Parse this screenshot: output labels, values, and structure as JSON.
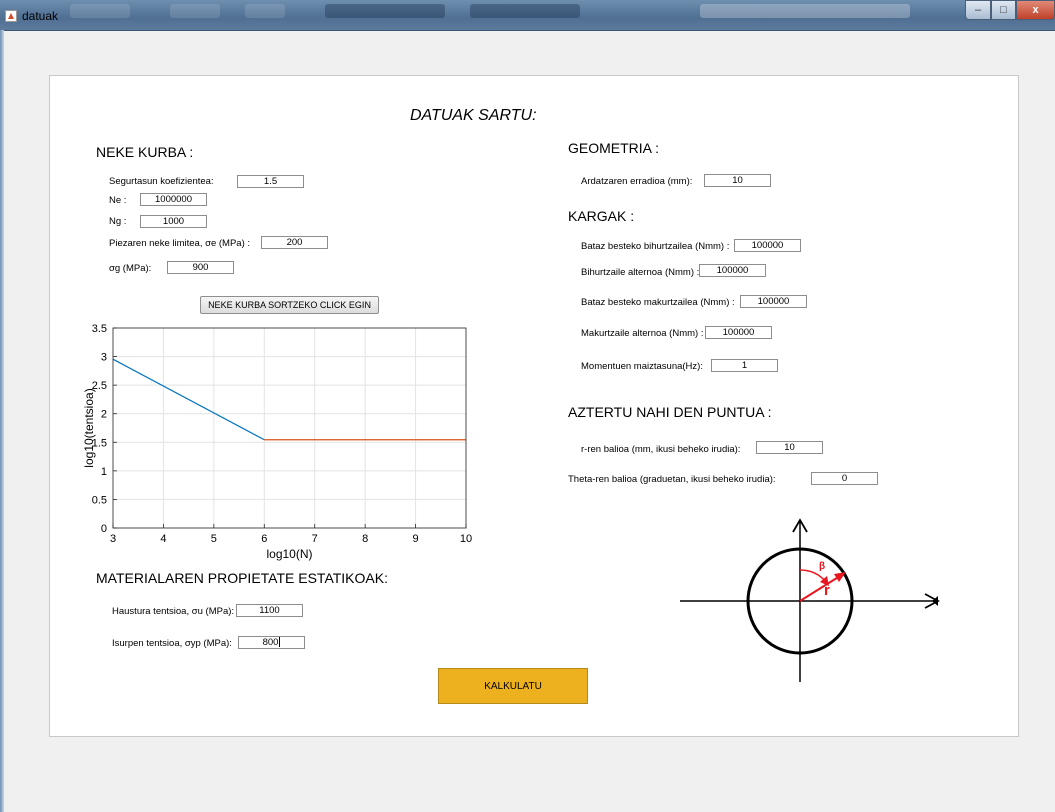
{
  "window": {
    "title": "datuak",
    "minimize": "–",
    "maximize": "□",
    "close": "x"
  },
  "main_title": "DATUAK SARTU:",
  "neke": {
    "heading": "NEKE KURBA :",
    "segurtasun_label": "Segurtasun koefizientea:",
    "segurtasun_value": "1.5",
    "ne_label": "Ne :",
    "ne_value": "1000000",
    "ng_label": "Ng :",
    "ng_value": "1000",
    "limitea_label": "Piezaren neke limitea, σe (MPa) :",
    "limitea_value": "200",
    "sg_label": "σg (MPa):",
    "sg_value": "900",
    "button": "NEKE KURBA SORTZEKO CLICK EGIN"
  },
  "chart_data": {
    "type": "line",
    "xlabel": "log10(N)",
    "ylabel": "log10(tentsioa)",
    "xlim": [
      3,
      10
    ],
    "ylim": [
      0,
      3.5
    ],
    "xticks": [
      "3",
      "4",
      "5",
      "6",
      "7",
      "8",
      "9",
      "10"
    ],
    "yticks": [
      "0",
      "0.5",
      "1",
      "1.5",
      "2",
      "2.5",
      "3",
      "3.5"
    ],
    "grid": true,
    "series": [
      {
        "color": "#0072bd",
        "x": [
          3,
          6
        ],
        "y": [
          2.954,
          1.544
        ]
      },
      {
        "color": "#d95319",
        "x": [
          6,
          10
        ],
        "y": [
          1.544,
          1.544
        ]
      }
    ]
  },
  "materiala": {
    "heading": "MATERIALAREN PROPIETATE ESTATIKOAK:",
    "haustura_label": "Haustura tentsioa, σu (MPa):",
    "haustura_value": "1100",
    "isurpen_label": "Isurpen tentsioa, σyp (MPa):",
    "isurpen_value": "800"
  },
  "geometria": {
    "heading": "GEOMETRIA :",
    "erradioa_label": "Ardatzaren erradioa (mm):",
    "erradioa_value": "10"
  },
  "kargak": {
    "heading": "KARGAK :",
    "bihurtz_label": "Bataz besteko bihurtzailea (Nmm) :",
    "bihurtz_value": "100000",
    "bihurtz_alt_label": "Bihurtzaile alternoa (Nmm) :",
    "bihurtz_alt_value": "100000",
    "makurtz_label": "Bataz besteko makurtzailea (Nmm) :",
    "makurtz_value": "100000",
    "makurtz_alt_label": "Makurtzaile alternoa (Nmm) :",
    "makurtz_alt_value": "100000",
    "maiztasuna_label": "Momentuen maiztasuna(Hz):",
    "maiztasuna_value": "1"
  },
  "puntua": {
    "heading": "AZTERTU NAHI DEN PUNTUA :",
    "r_label": "r-ren balioa (mm, ikusi beheko irudia):",
    "r_value": "10",
    "theta_label": "Theta-ren balioa (graduetan, ikusi beheko irudia):",
    "theta_value": "0"
  },
  "diagram": {
    "beta_label": "β",
    "r_label": "r",
    "arrow_color": "#e8161f"
  },
  "calc_button": "KALKULATU"
}
